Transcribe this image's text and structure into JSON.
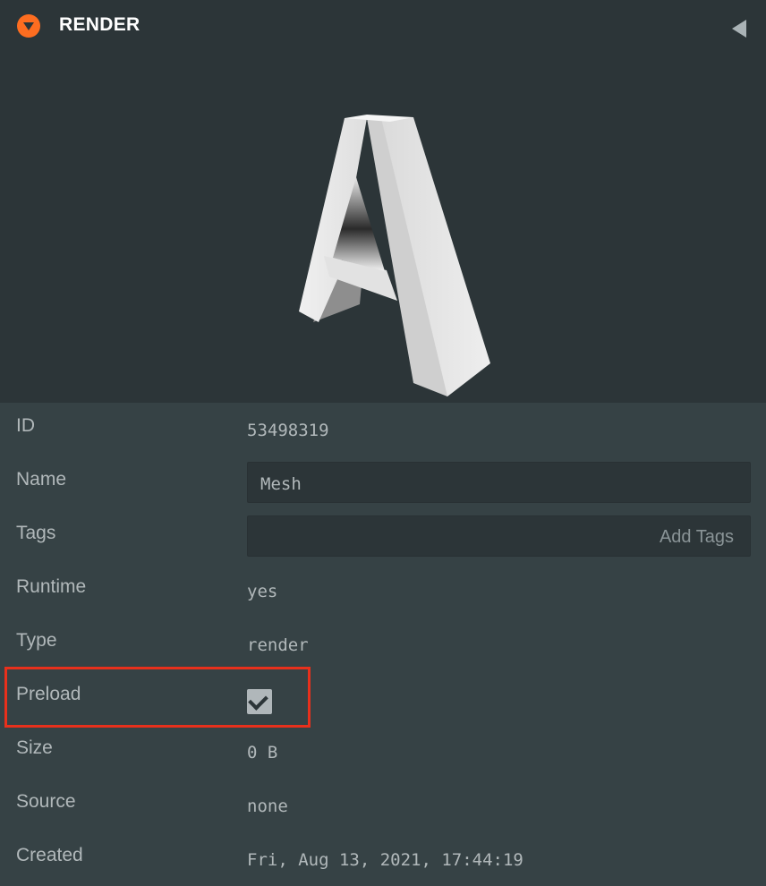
{
  "header": {
    "title": "RENDER"
  },
  "fields": {
    "id": {
      "label": "ID",
      "value": "53498319"
    },
    "name": {
      "label": "Name",
      "value": "Mesh"
    },
    "tags": {
      "label": "Tags",
      "placeholder": "Add Tags"
    },
    "runtime": {
      "label": "Runtime",
      "value": "yes"
    },
    "type": {
      "label": "Type",
      "value": "render"
    },
    "preload": {
      "label": "Preload",
      "checked": true
    },
    "size": {
      "label": "Size",
      "value": "0 B"
    },
    "source": {
      "label": "Source",
      "value": "none"
    },
    "created": {
      "label": "Created",
      "value": "Fri, Aug 13, 2021, 17:44:19"
    }
  },
  "colors": {
    "accent": "#fd6d20",
    "background": "#364245",
    "header_background": "#2c3538",
    "highlight": "#e8301c"
  },
  "icons": {
    "collapse": "chevron-down-circle-icon",
    "side_panel": "triangle-left-icon",
    "checkbox": "check-icon"
  }
}
